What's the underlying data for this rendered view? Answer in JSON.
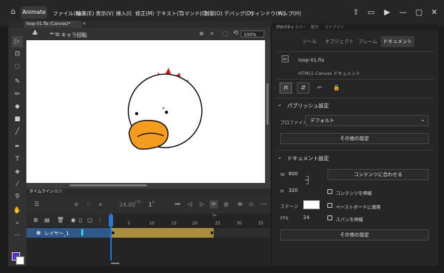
{
  "app": {
    "name": "Animate"
  },
  "menu": [
    "ファイル(F)",
    "編集(E)",
    "表示(V)",
    "挿入(I)",
    "修正(M)",
    "テキスト(T)",
    "コマンド(C)",
    "制御(O)",
    "デバッグ(D)",
    "ウィンドウ(W)",
    "ヘルプ(H)"
  ],
  "document": {
    "tab_label": "loop-01.fla (Canvas)*"
  },
  "stage": {
    "scene_name": "キャラ回転",
    "zoom": "100%"
  },
  "timeline": {
    "tab_timeline": "タイムライン",
    "tab_output": "出力",
    "fps": "24.00",
    "fps_unit": "FPS",
    "frame_current": "1",
    "frame_unit": "F",
    "ruler_labels": [
      "1s",
      "5",
      "10",
      "15",
      "20",
      "25",
      "30",
      "35"
    ],
    "layer_name": "レイヤー_1"
  },
  "properties": {
    "panel_tabs": [
      "プロパティ",
      "カラー",
      "整列",
      "ライブラリ"
    ],
    "sub_tabs": [
      "ツール",
      "オブジェクト",
      "フレーム",
      "ドキュメント"
    ],
    "active_sub_tab": "ドキュメント",
    "doc_name": "loop-01.fla",
    "doc_type": "HTML5 Canvas ドキュメント",
    "publish": {
      "section_title": "パブリッシュ設定",
      "profile_label": "プロファイル",
      "profile_value": "デフォルト",
      "more_button": "その他の設定"
    },
    "doc_settings": {
      "section_title": "ドキュメント設定",
      "width_label": "W",
      "width_value": "600",
      "height_label": "H",
      "height_value": "320",
      "fit_button": "コンテンツに合わせる",
      "scale_content": "コンテンツを伸縮",
      "apply_pasteboard": "ペーストボードに適用",
      "scale_spans": "スパンを伸縮",
      "stage_label": "ステージ",
      "stage_color": "#ffffff",
      "fps_label": "FPS",
      "fps_value": "24",
      "more_button": "その他の設定"
    }
  },
  "colors": {
    "accent": "#2a79d6",
    "frame_span": "#a88e3d",
    "layer_selected": "#2f5787",
    "stroke_color": "#5b2fc9"
  }
}
